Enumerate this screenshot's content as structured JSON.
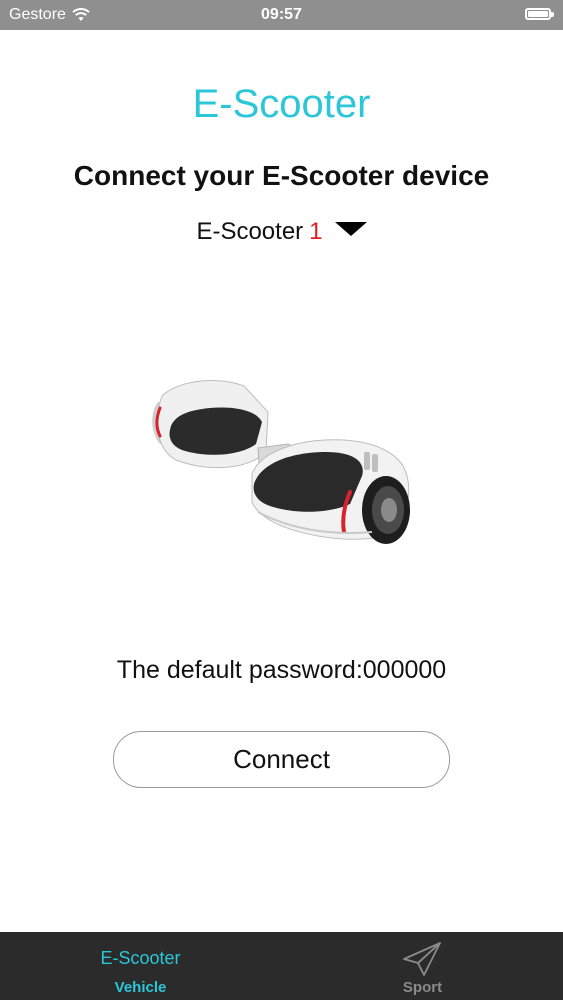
{
  "status_bar": {
    "carrier": "Gestore",
    "time": "09:57",
    "wifi_icon": "wifi-icon",
    "battery_icon": "battery-icon"
  },
  "header": {
    "title": "E-Scooter",
    "subtitle": "Connect your E-Scooter device"
  },
  "device_selector": {
    "name": "E-Scooter",
    "number": "1",
    "icon": "caret-down-icon"
  },
  "main": {
    "image": "hoverboard-scooter-image",
    "password_text": "The default password:000000",
    "connect_label": "Connect"
  },
  "tab_bar": {
    "tabs": [
      {
        "icon_text": "E-Scooter",
        "label": "Vehicle",
        "active": true
      },
      {
        "icon": "paper-plane-icon",
        "label": "Sport",
        "active": false
      }
    ]
  },
  "colors": {
    "accent": "#2bc6d8",
    "highlight": "#e02020",
    "status_bar_bg": "#8f8f8f",
    "tab_bar_bg": "#2b2b2b",
    "inactive_tab": "#8a8a8a"
  }
}
